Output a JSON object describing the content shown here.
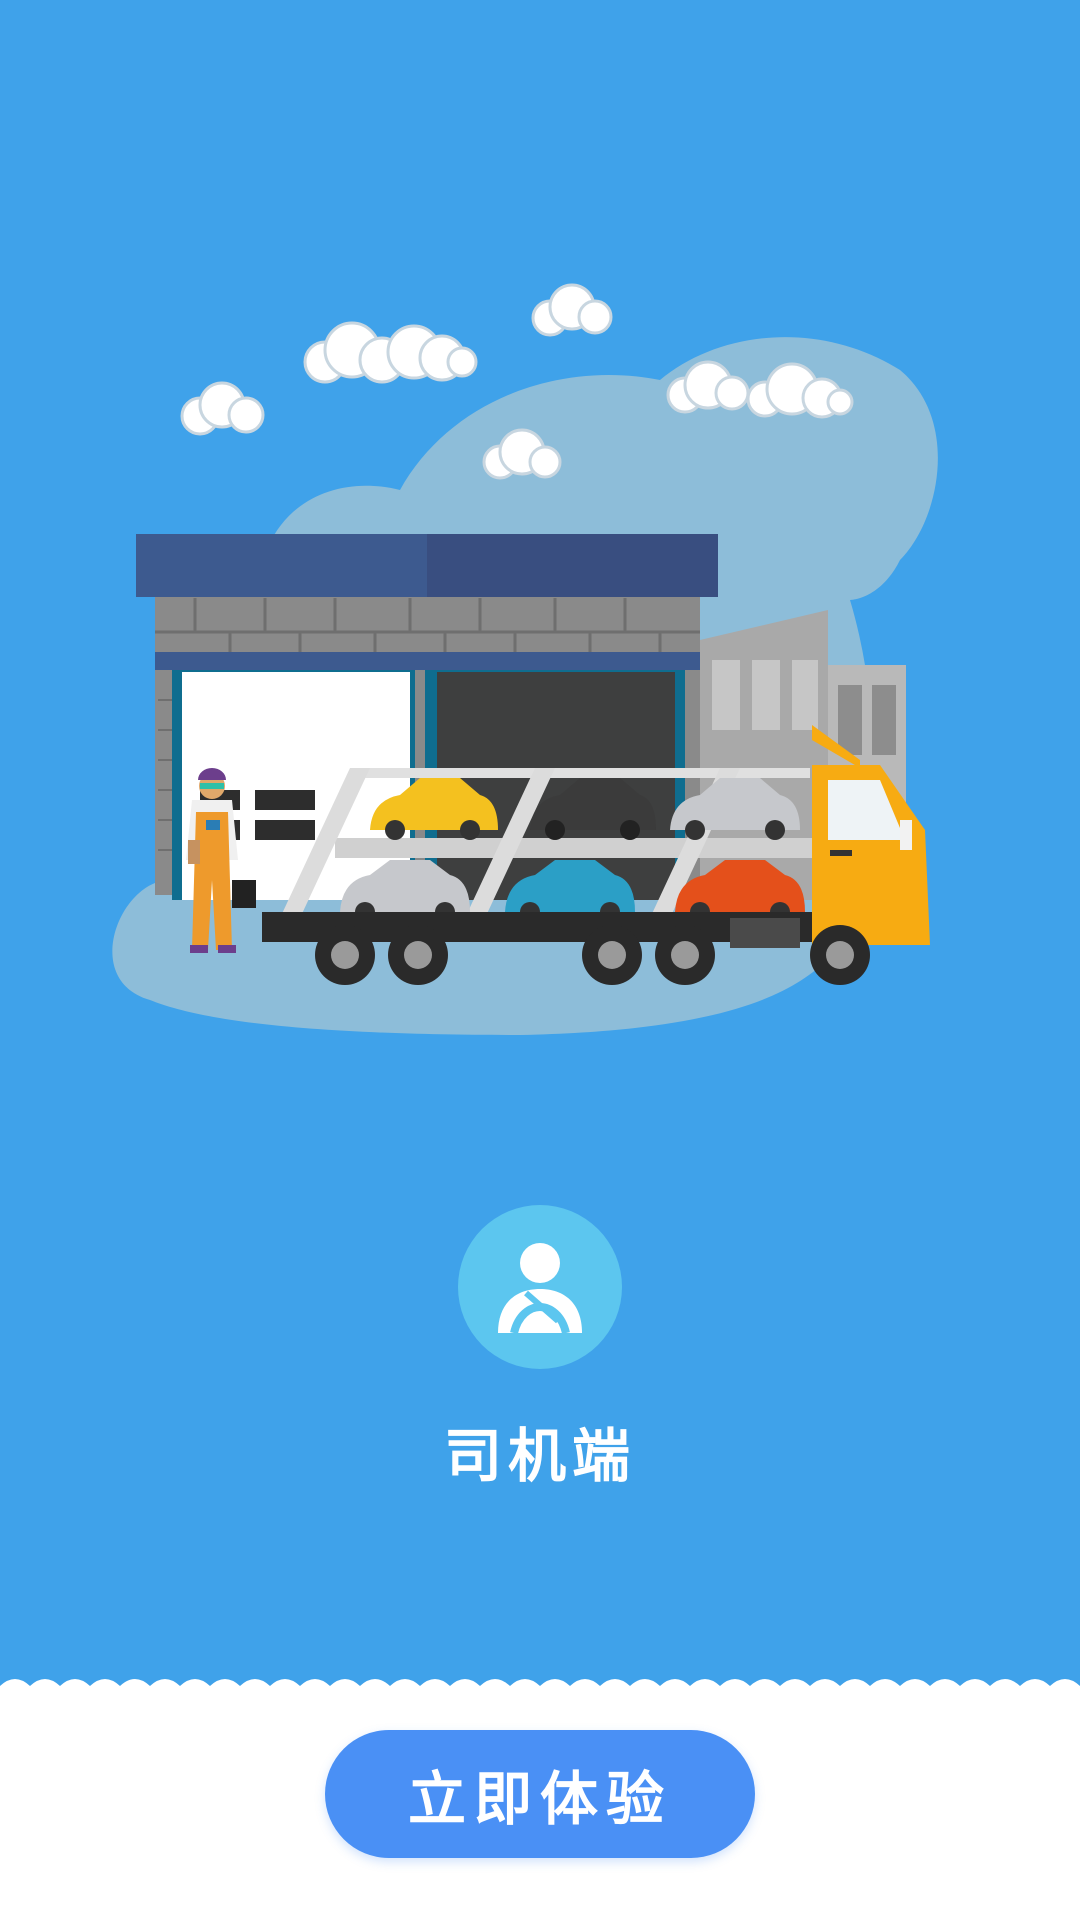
{
  "role": {
    "icon": "driver-seatbelt-icon",
    "label": "司机端"
  },
  "cta": {
    "label": "立即体验"
  },
  "colors": {
    "background": "#3fa2ea",
    "avatar_circle": "#5cc6ef",
    "button": "#4a90f5",
    "text": "#ffffff"
  },
  "illustration": "car-carrier-truck-warehouse-illustration"
}
